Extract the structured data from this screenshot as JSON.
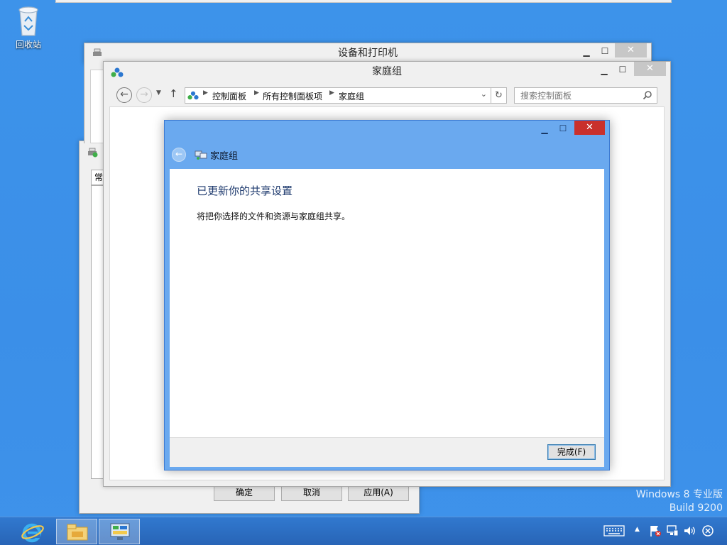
{
  "desktop": {
    "recycle_bin_label": "回收站",
    "watermark_line1": "Windows 8 专业版",
    "watermark_line2": "Build 9200"
  },
  "windows": {
    "devices": {
      "title": "设备和打印机"
    },
    "homegroup": {
      "title": "家庭组",
      "address": [
        "控制面板",
        "所有控制面板项",
        "家庭组"
      ],
      "search_placeholder": "搜索控制面板"
    },
    "properties": {
      "tab_label": "常",
      "buttons": {
        "ok": "确定",
        "cancel": "取消",
        "apply": "应用(A)"
      }
    }
  },
  "dialog": {
    "header_title": "家庭组",
    "heading": "已更新你的共享设置",
    "description": "将把你选择的文件和资源与家庭组共享。",
    "finish_button": "完成(F)"
  },
  "taskbar": {
    "apps": [
      "internet-explorer-icon",
      "file-explorer-icon",
      "control-panel-icon"
    ]
  }
}
